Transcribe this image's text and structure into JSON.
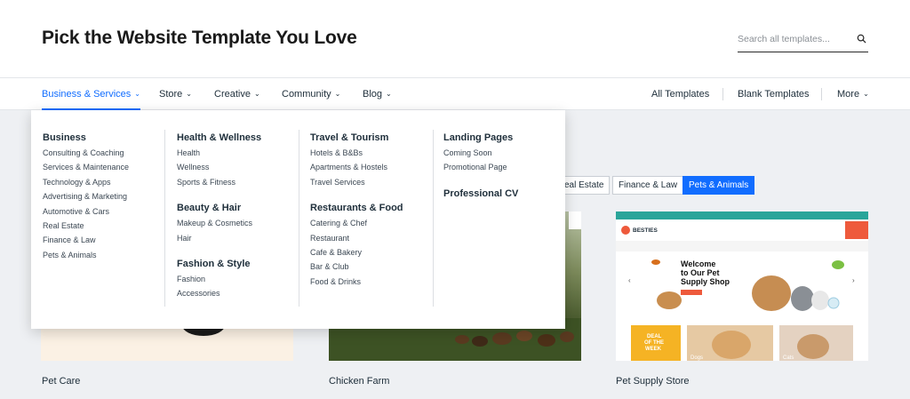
{
  "header": {
    "title": "Pick the Website Template You Love",
    "search_placeholder": "Search all templates..."
  },
  "nav": {
    "left": [
      {
        "label": "Business & Services",
        "active": true
      },
      {
        "label": "Store"
      },
      {
        "label": "Creative"
      },
      {
        "label": "Community"
      },
      {
        "label": "Blog"
      }
    ],
    "right": [
      {
        "label": "All Templates"
      },
      {
        "label": "Blank Templates"
      },
      {
        "label": "More"
      }
    ]
  },
  "dropdown": {
    "columns": [
      {
        "groups": [
          {
            "title": "Business",
            "links": [
              "Consulting & Coaching",
              "Services & Maintenance",
              "Technology & Apps",
              "Advertising & Marketing",
              "Automotive & Cars",
              "Real Estate",
              "Finance & Law",
              "Pets & Animals"
            ]
          }
        ]
      },
      {
        "groups": [
          {
            "title": "Health & Wellness",
            "links": [
              "Health",
              "Wellness",
              "Sports & Fitness"
            ]
          },
          {
            "title": "Beauty & Hair",
            "links": [
              "Makeup & Cosmetics",
              "Hair"
            ]
          },
          {
            "title": "Fashion & Style",
            "links": [
              "Fashion",
              "Accessories"
            ]
          }
        ]
      },
      {
        "groups": [
          {
            "title": "Travel & Tourism",
            "links": [
              "Hotels & B&Bs",
              "Apartments & Hostels",
              "Travel Services"
            ]
          },
          {
            "title": "Restaurants & Food",
            "links": [
              "Catering & Chef",
              "Restaurant",
              "Cafe & Bakery",
              "Bar & Club",
              "Food & Drinks"
            ]
          }
        ]
      },
      {
        "groups": [
          {
            "title": "Landing Pages",
            "links": [
              "Coming Soon",
              "Promotional Page"
            ]
          },
          {
            "title": "Professional CV",
            "links": []
          }
        ]
      }
    ]
  },
  "filters": [
    {
      "label": "eal Estate",
      "active": false
    },
    {
      "label": "Finance & Law",
      "active": false
    },
    {
      "label": "Pets & Animals",
      "active": true
    }
  ],
  "cards": [
    {
      "label": "Pet Care"
    },
    {
      "label": "Chicken Farm"
    },
    {
      "label": "Pet Supply Store"
    }
  ],
  "supply_preview": {
    "brand": "BESTIES",
    "hero_line1": "Welcome",
    "hero_line2": "to Our Pet",
    "hero_line3": "Supply Shop",
    "deal_line1": "DEAL",
    "deal_line2": "OF THE",
    "deal_line3": "WEEK",
    "tile_dogs": "Dogs",
    "tile_cats": "Cats"
  },
  "colors": {
    "accent": "#116dff",
    "teal": "#2aa59a",
    "coral": "#ee5a3c",
    "deal_yellow": "#f5b324"
  },
  "icons": {
    "search": "search-icon",
    "chevron": "chevron-down-icon"
  }
}
